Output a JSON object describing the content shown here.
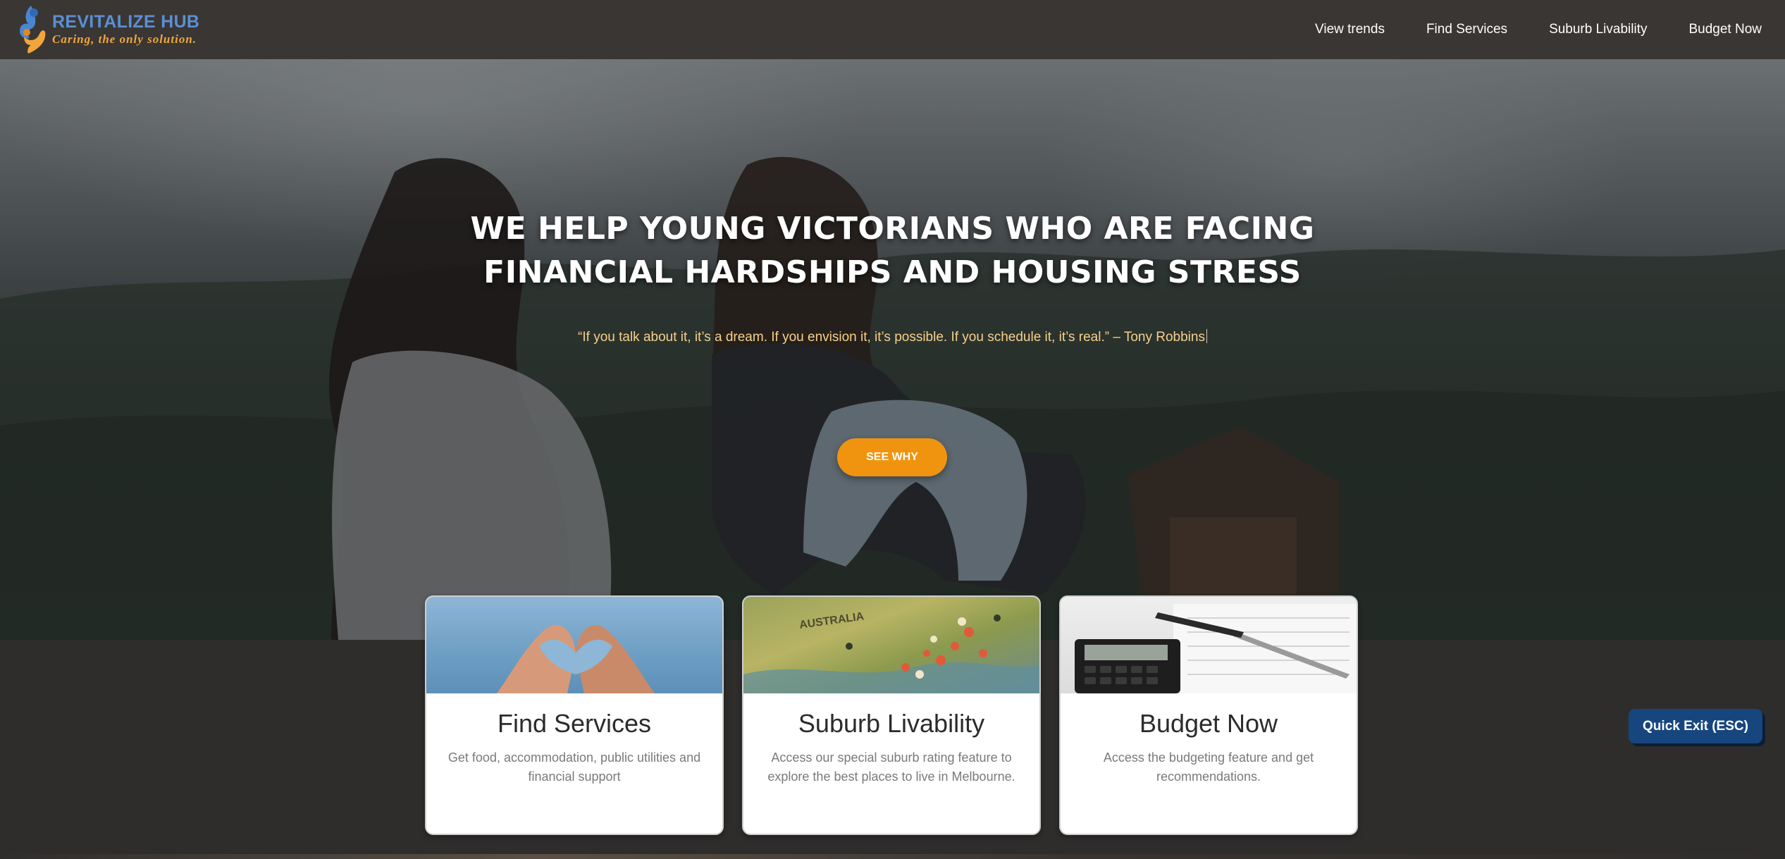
{
  "brand": {
    "name": "REVITALIZE HUB",
    "tagline": "Caring, the only solution."
  },
  "nav": {
    "links": [
      "View trends",
      "Find Services",
      "Suburb Livability",
      "Budget Now"
    ]
  },
  "hero": {
    "heading_line1": "WE HELP YOUNG VICTORIANS WHO ARE FACING",
    "heading_line2": "FINANCIAL HARDSHIPS AND HOUSING STRESS",
    "quote": "“If you talk about it, it’s a dream. If you envision it, it’s possible. If you schedule it, it’s real.” – Tony Robbins",
    "button_label": "SEE WHY"
  },
  "cards": [
    {
      "title": "Find Services",
      "description": "Get food, accommodation, public utilities and financial support",
      "image": "hands-heart-image"
    },
    {
      "title": "Suburb Livability",
      "description": "Access our special suburb rating feature to explore the best places to live in Melbourne.",
      "image": "australia-map-pins-image"
    },
    {
      "title": "Budget Now",
      "description": "Access the budgeting feature and get recommendations.",
      "image": "calculator-pen-image"
    }
  ],
  "quick_exit": {
    "label": "Quick Exit (ESC)"
  },
  "colors": {
    "navbar": "#3a3634",
    "brand_blue": "#5b8fd3",
    "brand_orange": "#f0a63c",
    "cta_orange": "#f0940f",
    "quote_text": "#f6d08a",
    "quick_exit": "#17467f",
    "page_bg": "#2f2d2c"
  }
}
